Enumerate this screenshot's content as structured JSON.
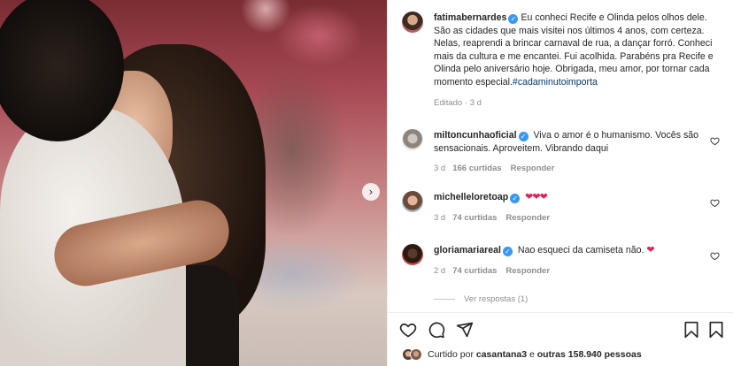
{
  "post": {
    "author": {
      "username": "fatimabernardes",
      "avatar_icon": "profile-avatar",
      "verified": true
    },
    "caption": "Eu conheci Recife e Olinda pelos olhos dele. São as cidades que mais visitei nos últimos 4 anos, com certeza. Nelas, reaprendi a brincar carnaval de rua, a dançar forró. Conheci mais da cultura e me encantei. Fui acolhida. Parabéns pra Recife e Olinda pelo aniversário hoje. Obrigada, meu amor, por tornar cada momento especial.",
    "hashtag": "#cadaminutoimporta",
    "edited_label": "Editado",
    "time_ago": "3 d",
    "carousel_next_icon": "chevron-right-icon"
  },
  "comments": [
    {
      "username": "miltoncunhaoficial",
      "verified": true,
      "text": "Viva o amor é o humanismo. Vocês são sensacionais. Aproveitem. Vibrando daqui",
      "time_ago": "3 d",
      "likes": "166 curtidas",
      "reply_label": "Responder"
    },
    {
      "username": "michelleloretoap",
      "verified": true,
      "text": "",
      "emoji": "❤❤❤",
      "time_ago": "3 d",
      "likes": "74 curtidas",
      "reply_label": "Responder"
    },
    {
      "username": "gloriamariareal",
      "verified": true,
      "text": "Nao esqueci da camiseta não.",
      "emoji": "❤",
      "time_ago": "2 d",
      "likes": "74 curtidas",
      "reply_label": "Responder",
      "view_replies": "Ver respostas (1)"
    }
  ],
  "actions": {
    "like_icon": "heart-icon",
    "comment_icon": "comment-icon",
    "share_icon": "share-icon",
    "save_icon": "bookmark-icon",
    "more_icon": "more-icon"
  },
  "liked_by": {
    "prefix": "Curtido por",
    "user": "casantana3",
    "middle": "e",
    "others": "outras 158.940 pessoas"
  },
  "colors": {
    "verified": "#3897f0",
    "hashtag": "#00376b",
    "muted": "#8e8e8e",
    "heart_emoji": "#e0245e"
  }
}
